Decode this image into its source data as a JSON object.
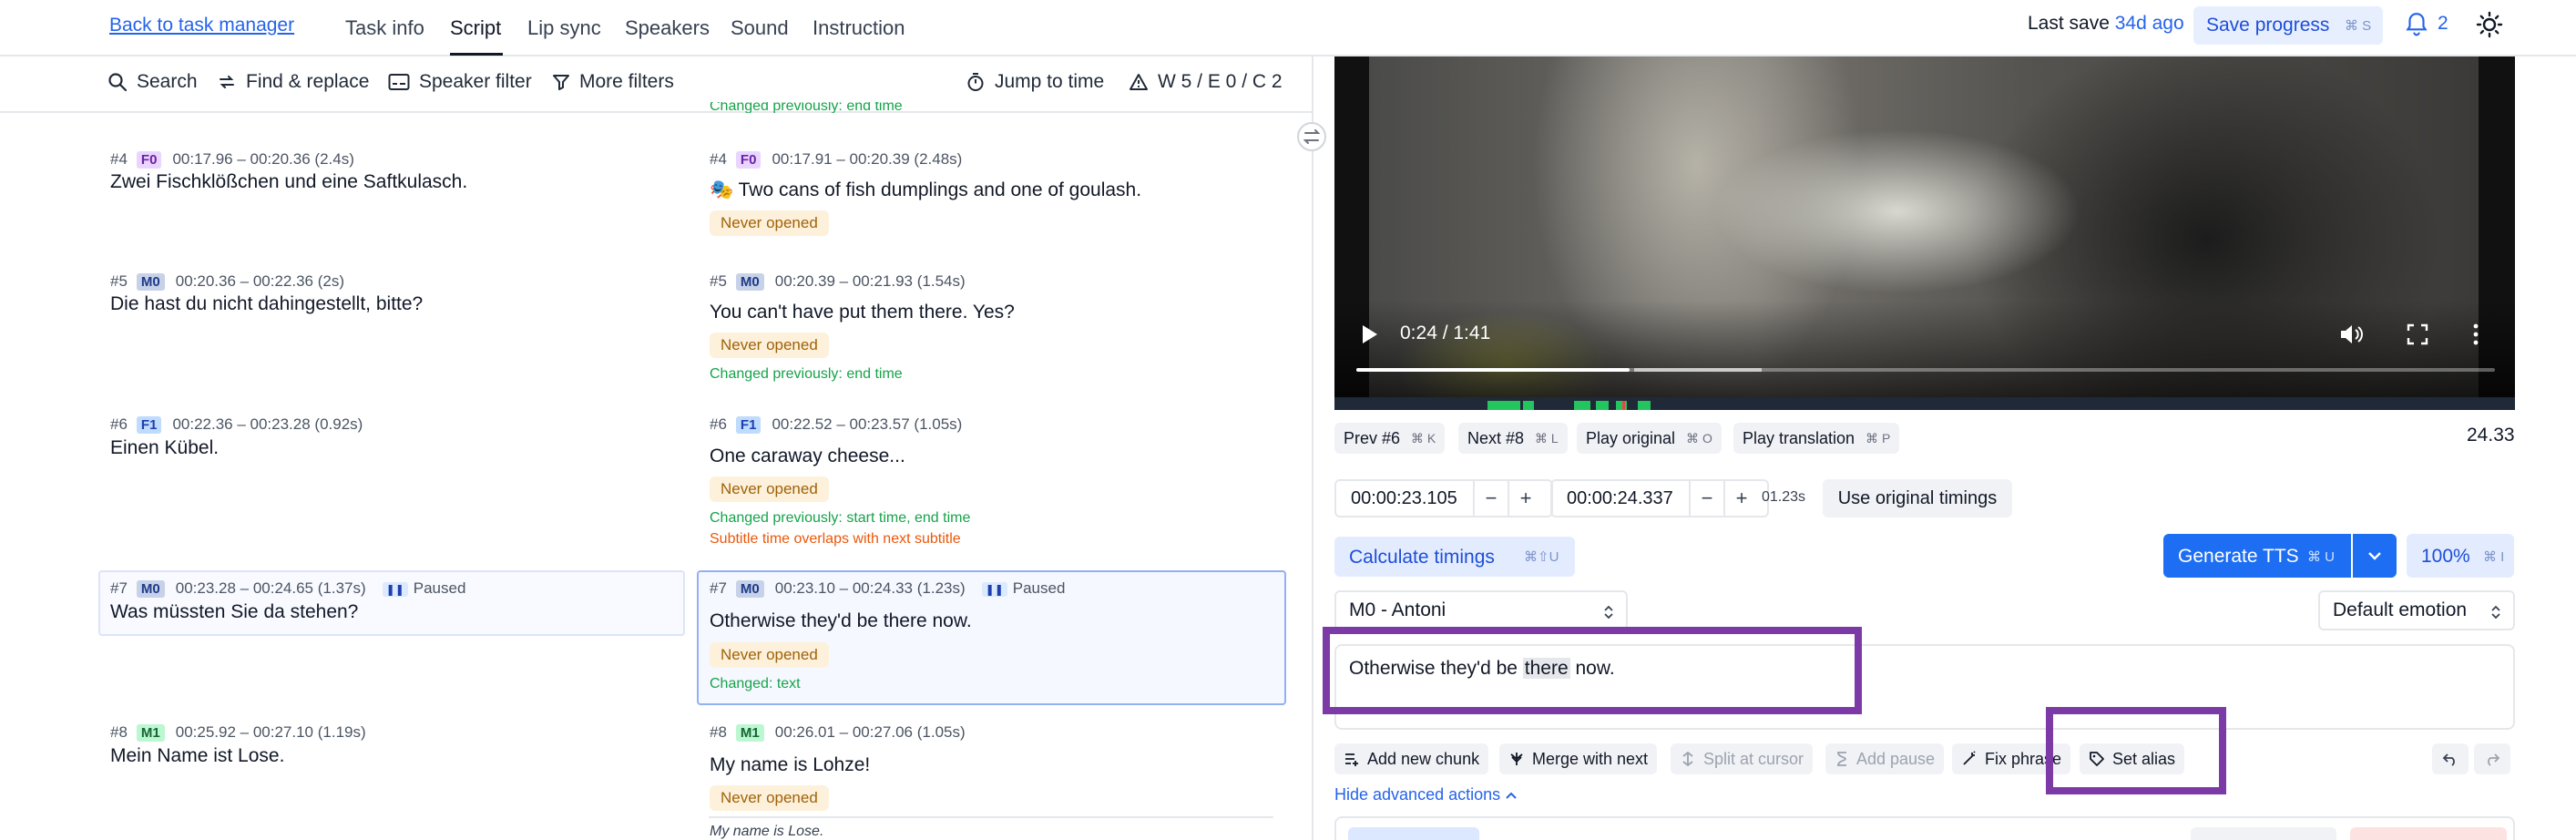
{
  "header": {
    "back_link": "Back to task manager",
    "tabs": [
      {
        "label": "Task info"
      },
      {
        "label": "Script"
      },
      {
        "label": "Lip sync"
      },
      {
        "label": "Speakers"
      },
      {
        "label": "Sound"
      },
      {
        "label": "Instruction"
      }
    ],
    "active_tab": "Script",
    "last_save_label": "Last save",
    "last_save_ago": "34d ago",
    "save_button": "Save progress",
    "save_shortcut": "⌘ S",
    "notification_count": "2"
  },
  "toolbar": {
    "search": "Search",
    "find_replace": "Find & replace",
    "speaker_filter": "Speaker filter",
    "more_filters": "More filters",
    "jump_to_time": "Jump to time",
    "warnings": "W 5 / E 0 / C 2"
  },
  "cutoff_note": "Changed previously: end time",
  "original_lines": [
    {
      "num": "#4",
      "speaker": "F0",
      "time": "00:17.96 – 00:20.36 (2.4s)",
      "text": "Zwei Fischklößchen und eine Saftkulasch.",
      "paused": ""
    },
    {
      "num": "#5",
      "speaker": "M0",
      "time": "00:20.36 – 00:22.36 (2s)",
      "text": "Die hast du nicht dahingestellt, bitte?",
      "paused": ""
    },
    {
      "num": "#6",
      "speaker": "F1",
      "time": "00:22.36 – 00:23.28 (0.92s)",
      "text": "Einen Kübel.",
      "paused": ""
    },
    {
      "num": "#7",
      "speaker": "M0",
      "time": "00:23.28 – 00:24.65 (1.37s)",
      "text": "Was müssten Sie da stehen?",
      "paused": "Paused"
    },
    {
      "num": "#8",
      "speaker": "M1",
      "time": "00:25.92 – 00:27.10 (1.19s)",
      "text": "Mein Name ist Lose.",
      "paused": ""
    }
  ],
  "translated_lines": [
    {
      "num": "#4",
      "speaker": "F0",
      "time": "00:17.91 – 00:20.39 (2.48s)",
      "text": "Two cans of fish dumplings and one of goulash.",
      "emoji": "🎭",
      "status": "Never opened",
      "notes": [],
      "paused": ""
    },
    {
      "num": "#5",
      "speaker": "M0",
      "time": "00:20.39 – 00:21.93 (1.54s)",
      "text": "You can't have put them there. Yes?",
      "status": "Never opened",
      "notes": [
        "Changed previously: end time"
      ],
      "paused": ""
    },
    {
      "num": "#6",
      "speaker": "F1",
      "time": "00:22.52 – 00:23.57 (1.05s)",
      "text": "One caraway cheese...",
      "status": "Never opened",
      "notes": [
        "Changed previously: start time, end time"
      ],
      "warning": "Subtitle time overlaps with next subtitle",
      "paused": ""
    },
    {
      "num": "#7",
      "speaker": "M0",
      "time": "00:23.10 – 00:24.33 (1.23s)",
      "text": "Otherwise they'd be there now.",
      "status": "Never opened",
      "notes": [
        "Changed: text"
      ],
      "paused": "Paused"
    },
    {
      "num": "#8",
      "speaker": "M1",
      "time": "00:26.01 – 00:27.06 (1.05s)",
      "text": "My name is Lohze!",
      "status": "Never opened",
      "notes": [],
      "original_preview": "My name is Lose.",
      "paused": ""
    }
  ],
  "video": {
    "time_display": "0:24 / 1:41",
    "progress_fraction": 0.24
  },
  "controls": {
    "prev": "Prev #6",
    "prev_key": "⌘ K",
    "next": "Next #8",
    "next_key": "⌘ L",
    "play_original": "Play original",
    "play_original_key": "⌘ O",
    "play_translation": "Play translation",
    "play_translation_key": "⌘ P",
    "current_time": "24.33",
    "start_time": "00:00:23.105",
    "end_time": "00:00:24.337",
    "duration": "01.23s",
    "use_original_timings": "Use original timings",
    "calculate_timings": "Calculate timings",
    "calculate_key": "⌘⇧U",
    "generate_tts": "Generate TTS",
    "generate_key": "⌘ U",
    "speed": "100%",
    "speed_key": "⌘ I",
    "voice": "M0 - Antoni",
    "emotion": "Default emotion",
    "editor_before": "Otherwise they'd be ",
    "editor_highlight": "there",
    "editor_after": " now."
  },
  "actions": {
    "add_new_chunk": "Add new chunk",
    "merge_with_next": "Merge with next",
    "split_at_cursor": "Split at cursor",
    "add_pause": "Add pause",
    "fix_phrase": "Fix phrase",
    "set_alias": "Set alias",
    "hide_advanced": "Hide advanced actions"
  },
  "colors": {
    "accent": "#1d6ef2",
    "highlight_box": "#7c3aa7",
    "never_opened_bg": "#fdf1dc",
    "changed_green": "#16a34a",
    "warning_orange": "#ea580c"
  }
}
